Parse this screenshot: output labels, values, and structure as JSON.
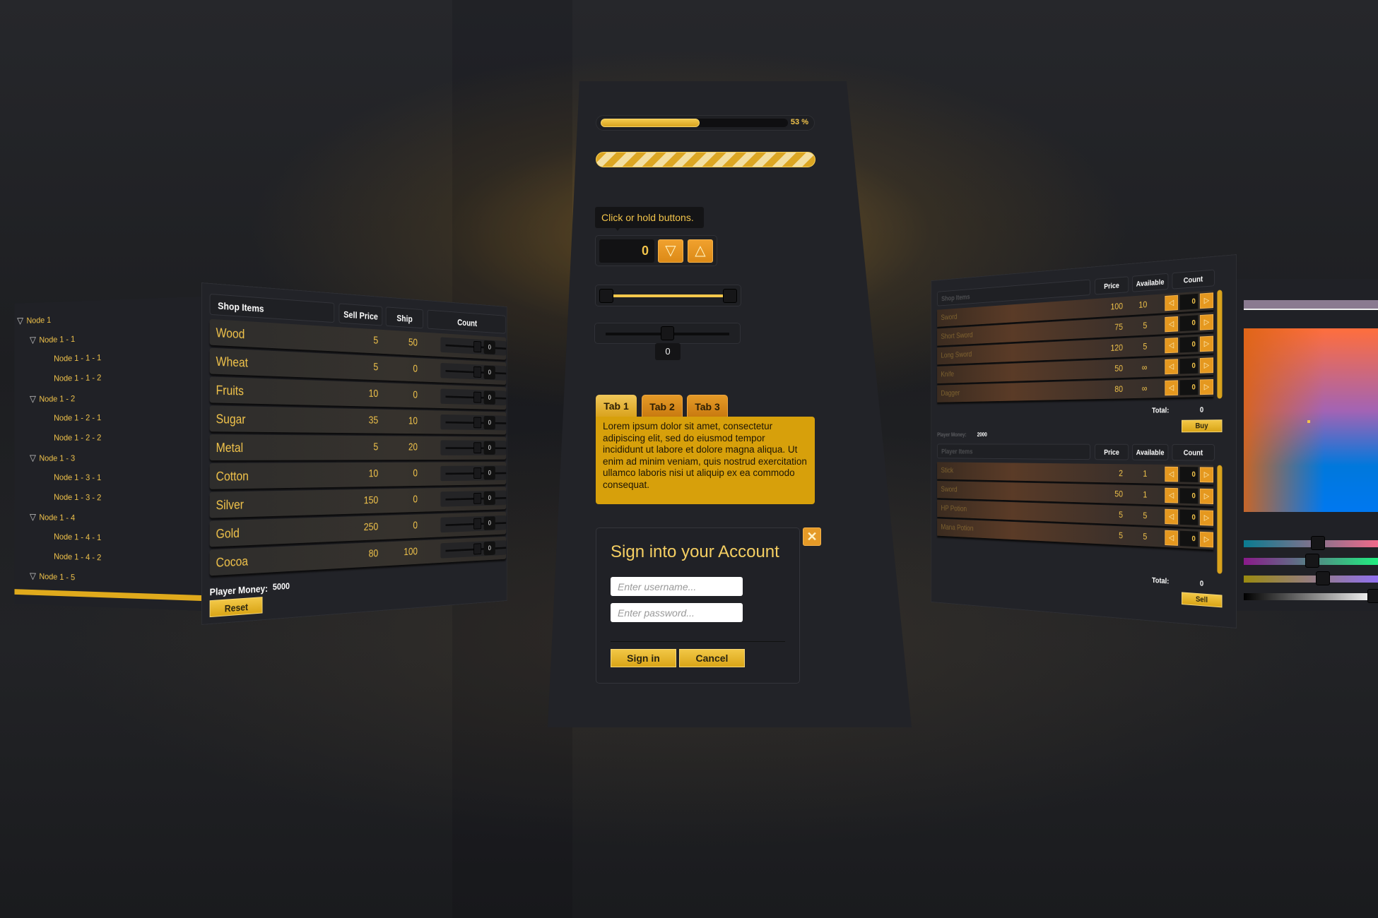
{
  "progress": {
    "value": 53,
    "label": "53 %"
  },
  "tooltip": "Click or hold buttons.",
  "spinner": {
    "value": "0",
    "down_icon": "triangle-down",
    "up_icon": "triangle-up"
  },
  "slider": {
    "value": "0"
  },
  "tabs": [
    {
      "label": "Tab 1",
      "active": true
    },
    {
      "label": "Tab 2"
    },
    {
      "label": "Tab 3"
    }
  ],
  "tab_content": "Lorem ipsum dolor sit amet, consectetur adipiscing elit, sed do eiusmod tempor incididunt ut labore et dolore magna aliqua. Ut enim ad minim veniam, quis nostrud exercitation ullamco laboris nisi ut aliquip ex ea commodo consequat.",
  "login": {
    "title": "Sign into your Account",
    "username_placeholder": "Enter username...",
    "password_placeholder": "Enter password...",
    "sign_in": "Sign in",
    "cancel": "Cancel",
    "close_icon": "x"
  },
  "tree": [
    {
      "label": "Node 1",
      "level": 0,
      "expanded": true
    },
    {
      "label": "Node 1 - 1",
      "level": 1,
      "expanded": true
    },
    {
      "label": "Node 1 - 1 - 1",
      "level": 2
    },
    {
      "label": "Node 1 - 1 - 2",
      "level": 2
    },
    {
      "label": "Node 1 - 2",
      "level": 1,
      "expanded": true
    },
    {
      "label": "Node 1 - 2 - 1",
      "level": 2
    },
    {
      "label": "Node 1 - 2 - 2",
      "level": 2
    },
    {
      "label": "Node 1 - 3",
      "level": 1,
      "expanded": true
    },
    {
      "label": "Node 1 - 3 - 1",
      "level": 2
    },
    {
      "label": "Node 1 - 3 - 2",
      "level": 2
    },
    {
      "label": "Node 1 - 4",
      "level": 1,
      "expanded": true
    },
    {
      "label": "Node 1 - 4 - 1",
      "level": 2
    },
    {
      "label": "Node 1 - 4 - 2",
      "level": 2
    },
    {
      "label": "Node 1 - 5",
      "level": 1,
      "expanded": true
    }
  ],
  "shop": {
    "headers": {
      "name": "Shop Items",
      "price": "Sell Price",
      "ship": "Ship",
      "count": "Count"
    },
    "rows": [
      {
        "name": "Wood",
        "price": "5",
        "ship": "50",
        "count": "0"
      },
      {
        "name": "Wheat",
        "price": "5",
        "ship": "0",
        "count": "0"
      },
      {
        "name": "Fruits",
        "price": "10",
        "ship": "0",
        "count": "0"
      },
      {
        "name": "Sugar",
        "price": "35",
        "ship": "10",
        "count": "0"
      },
      {
        "name": "Metal",
        "price": "5",
        "ship": "20",
        "count": "0"
      },
      {
        "name": "Cotton",
        "price": "10",
        "ship": "0",
        "count": "0"
      },
      {
        "name": "Silver",
        "price": "150",
        "ship": "0",
        "count": "0"
      },
      {
        "name": "Gold",
        "price": "250",
        "ship": "0",
        "count": "0"
      },
      {
        "name": "Cocoa",
        "price": "80",
        "ship": "100",
        "count": "0"
      }
    ],
    "money_label": "Player Money:",
    "money": "5000",
    "reset": "Reset"
  },
  "trade": {
    "shop": {
      "title": "Shop Items",
      "headers": {
        "price": "Price",
        "available": "Available",
        "count": "Count"
      },
      "rows": [
        {
          "name": "Sword",
          "price": "100",
          "available": "10",
          "count": "0"
        },
        {
          "name": "Short Sword",
          "price": "75",
          "available": "5",
          "count": "0"
        },
        {
          "name": "Long Sword",
          "price": "120",
          "available": "5",
          "count": "0"
        },
        {
          "name": "Knife",
          "price": "50",
          "available": "∞",
          "count": "0"
        },
        {
          "name": "Dagger",
          "price": "80",
          "available": "∞",
          "count": "0"
        }
      ],
      "total_label": "Total:",
      "total": "0",
      "button": "Buy"
    },
    "money_label": "Player Money:",
    "money": "2000",
    "player": {
      "title": "Player Items",
      "headers": {
        "price": "Price",
        "available": "Available",
        "count": "Count"
      },
      "rows": [
        {
          "name": "Stick",
          "price": "2",
          "available": "1",
          "count": "0"
        },
        {
          "name": "Sword",
          "price": "50",
          "available": "1",
          "count": "0"
        },
        {
          "name": "HP Potion",
          "price": "5",
          "available": "5",
          "count": "0"
        },
        {
          "name": "Mana Potion",
          "price": "5",
          "available": "5",
          "count": "0"
        }
      ],
      "total_label": "Total:",
      "total": "0",
      "button": "Sell"
    }
  },
  "colors": {
    "accent": "#f2c44b",
    "orange": "#e5981f",
    "panel": "#222328"
  }
}
